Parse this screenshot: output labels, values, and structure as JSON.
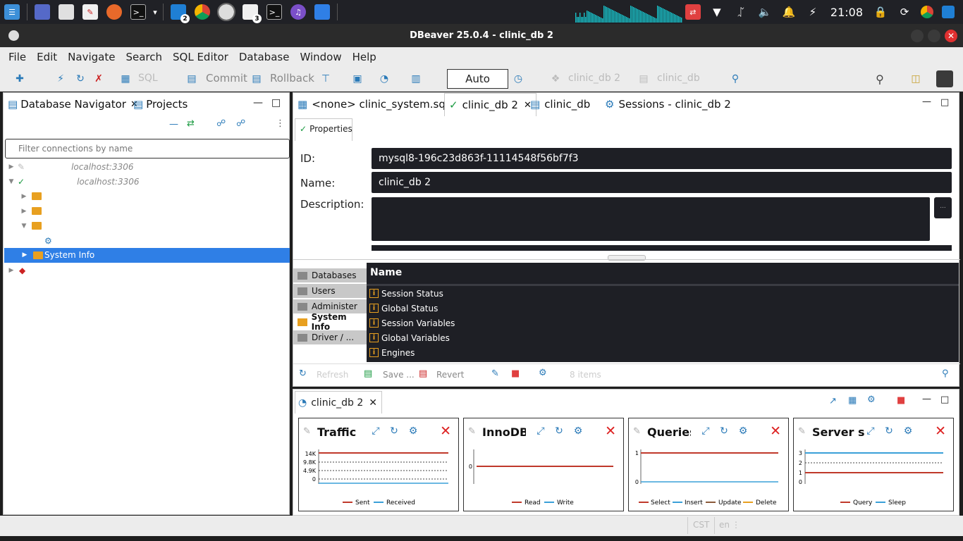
{
  "taskbar": {
    "badges": {
      "vscode": "2",
      "files": "3"
    },
    "clock": "21:08"
  },
  "window": {
    "title": "DBeaver 25.0.4 - clinic_db 2"
  },
  "menu": [
    "File",
    "Edit",
    "Navigate",
    "Search",
    "SQL Editor",
    "Database",
    "Window",
    "Help"
  ],
  "toolbar": {
    "sql": "SQL",
    "commit": "Commit",
    "rollback": "Rollback",
    "auto": "Auto",
    "datasource": "clinic_db 2",
    "schema": "clinic_db"
  },
  "navigator": {
    "tab1": "Database Navigator",
    "tab2": "Projects",
    "filter_placeholder": "Filter connections by name",
    "tree": {
      "conn1": "localhost:3306",
      "conn2": "localhost:3306",
      "selected": "System Info"
    }
  },
  "editor": {
    "tabs": [
      "<none> clinic_system.sql",
      "clinic_db 2",
      "clinic_db",
      "Sessions - clinic_db 2"
    ],
    "properties_tab": "Properties",
    "fields": {
      "id_label": "ID:",
      "id_value": "mysql8-196c23d863f-11114548f56bf7f3",
      "name_label": "Name:",
      "name_value": "clinic_db 2",
      "desc_label": "Description:"
    },
    "vtabs": [
      "Databases",
      "Users",
      "Administer",
      "System Info",
      "Driver / ..."
    ],
    "table_header": "Name",
    "rows": [
      "Session Status",
      "Global Status",
      "Session Variables",
      "Global Variables",
      "Engines"
    ],
    "bottom": {
      "refresh": "Refresh",
      "save": "Save ...",
      "revert": "Revert",
      "count": "8 items"
    }
  },
  "dashboard": {
    "tab": "clinic_db 2",
    "cards": [
      {
        "title": "Traffic",
        "legend": [
          "Sent",
          "Received"
        ],
        "ticks": [
          "14K",
          "9.8K",
          "4.9K",
          "0"
        ]
      },
      {
        "title": "InnoDB c",
        "legend": [
          "Read",
          "Write"
        ],
        "ticks": [
          "0"
        ]
      },
      {
        "title": "Queries",
        "legend": [
          "Select",
          "Insert",
          "Update",
          "Delete"
        ],
        "ticks": [
          "1",
          "0"
        ]
      },
      {
        "title": "Server se",
        "legend": [
          "Query",
          "Sleep"
        ],
        "ticks": [
          "3",
          "2",
          "1",
          "0"
        ]
      }
    ]
  },
  "status": {
    "tz": "CST",
    "lang": "en"
  },
  "colors": {
    "accent": "#2f7fe6",
    "dark": "#1e1f25",
    "red": "#c0392b",
    "blue": "#3aa0d8",
    "orange": "#e8a020"
  }
}
